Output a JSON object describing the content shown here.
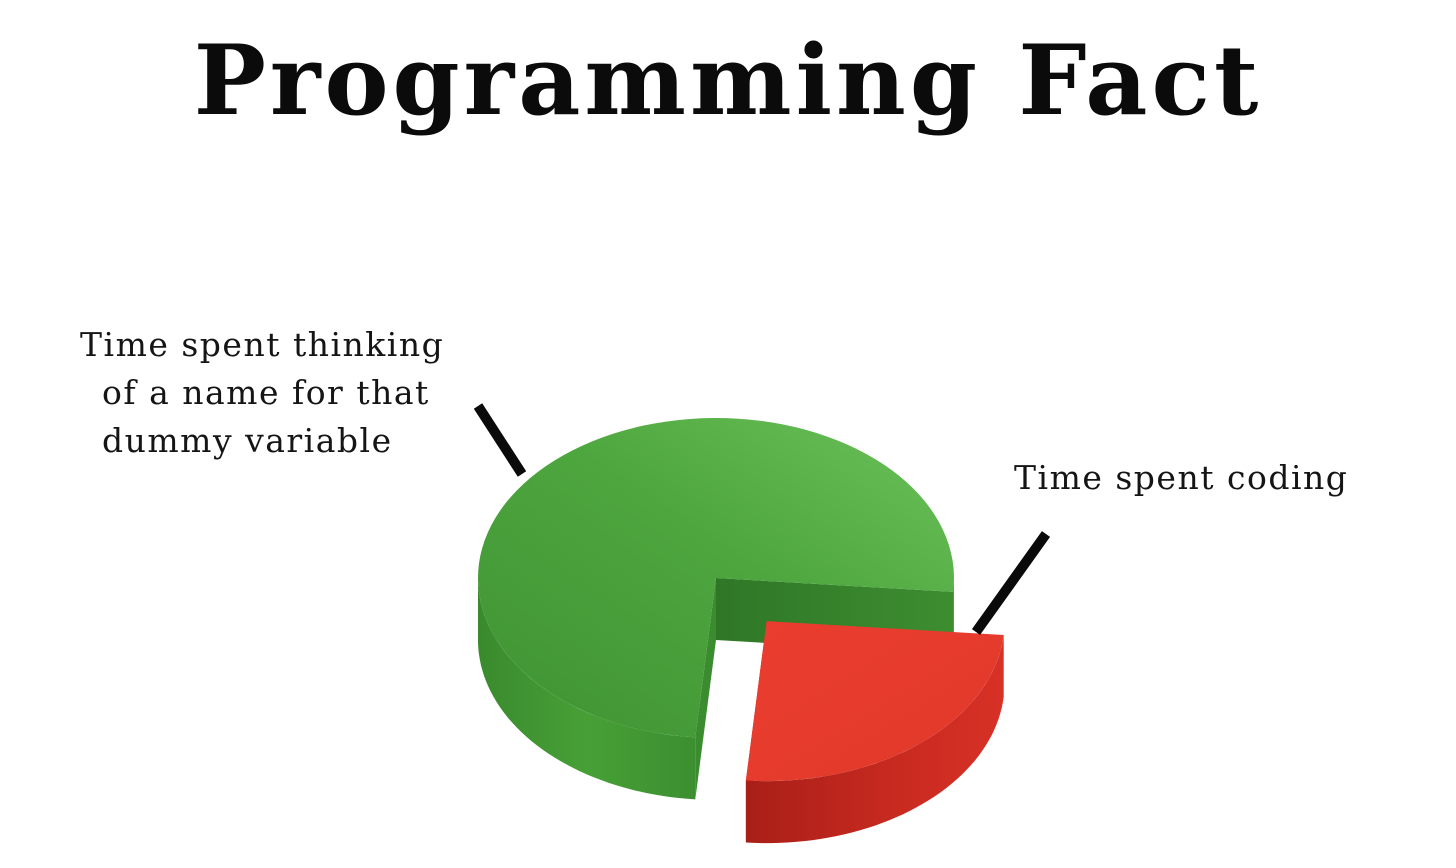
{
  "title": "Programming Fact",
  "chart_data": {
    "type": "pie",
    "style": "3d-exploded",
    "title": "Programming Fact",
    "slices": [
      {
        "label": "Time spent thinking of a name for that dummy variable",
        "label_lines": [
          "Time spent thinking",
          "of a name for that",
          "dummy variable"
        ],
        "value": 75,
        "color": "#4fa63f"
      },
      {
        "label": "Time spent coding",
        "label_lines": [
          "Time spent coding"
        ],
        "value": 25,
        "color": "#e8392c",
        "exploded": true
      }
    ],
    "legend": "none",
    "data_labels": "callout lines"
  }
}
